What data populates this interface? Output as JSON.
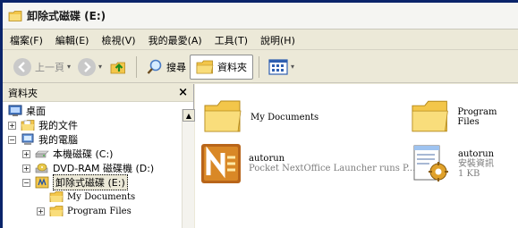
{
  "window": {
    "title": "卸除式磁碟 (E:)"
  },
  "menu": [
    "檔案(F)",
    "編輯(E)",
    "檢視(V)",
    "我的最愛(A)",
    "工具(T)",
    "說明(H)"
  ],
  "toolbar": {
    "back": "上一頁",
    "search": "搜尋",
    "folders": "資料夾"
  },
  "pane": {
    "title": "資料夾",
    "close": "×"
  },
  "tree": [
    {
      "label": "桌面",
      "icon": "desktop-icon",
      "expander": ""
    },
    {
      "label": "我的文件",
      "icon": "documents-icon",
      "expander": "+"
    },
    {
      "label": "我的電腦",
      "icon": "computer-icon",
      "expander": "−"
    },
    {
      "label": "本機磁碟 (C:)",
      "icon": "hard-drive-icon",
      "expander": "+"
    },
    {
      "label": "DVD-RAM 磁碟機 (D:)",
      "icon": "dvd-drive-icon",
      "expander": "+"
    },
    {
      "label": "卸除式磁碟 (E:)",
      "icon": "removable-drive-icon",
      "expander": "−"
    },
    {
      "label": "My Documents",
      "icon": "folder-icon",
      "expander": ""
    },
    {
      "label": "Program Files",
      "icon": "folder-icon",
      "expander": "+"
    }
  ],
  "files": [
    {
      "name": "My Documents",
      "type": "folder"
    },
    {
      "name": "Program Files",
      "type": "folder"
    },
    {
      "name": "autorun",
      "desc": "Pocket NextOffice Launcher runs P...",
      "size": "",
      "type": "app"
    },
    {
      "name": "autorun",
      "desc": "安裝資訊",
      "size": "1 KB",
      "type": "setup"
    }
  ],
  "colors": {
    "accent": "#0a246a",
    "folder": "#f7d57a",
    "selection_bg": "#ece9d8"
  }
}
